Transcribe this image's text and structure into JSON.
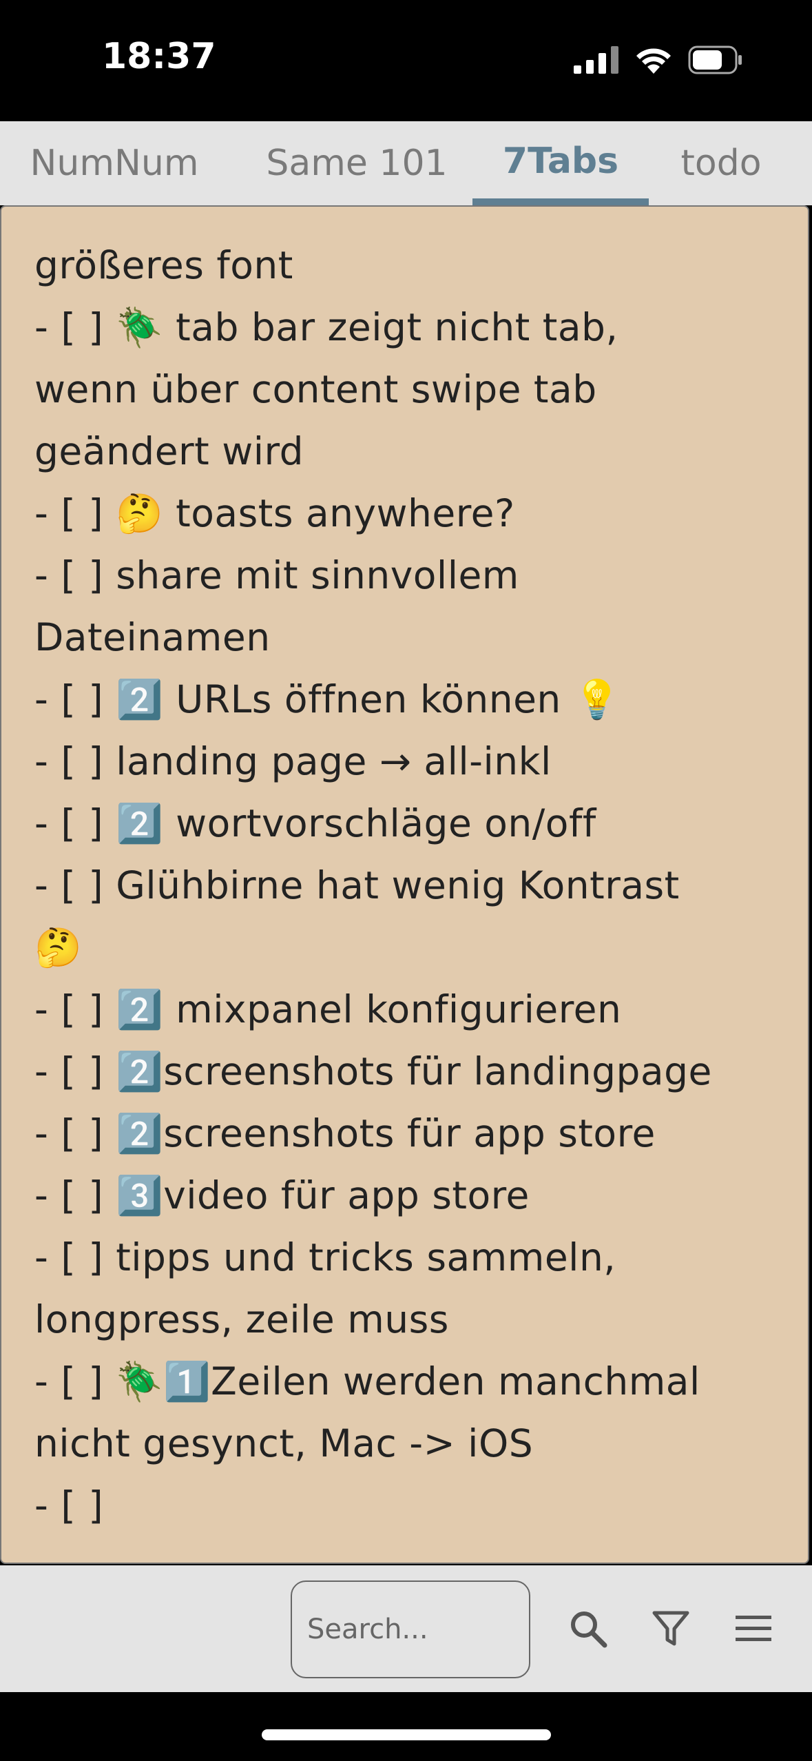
{
  "status_bar": {
    "time": "18:37"
  },
  "tabs": [
    {
      "label": "NumNum",
      "active": false
    },
    {
      "label": "Same 101",
      "active": false
    },
    {
      "label": "7Tabs",
      "active": true
    },
    {
      "label": "todo",
      "active": false
    }
  ],
  "content": {
    "background_color": "#e2cbae",
    "lines": [
      "größeres font",
      "- [ ] 🪲 tab bar zeigt nicht tab,",
      "wenn über content swipe tab",
      "geändert wird",
      "- [ ] 🤔  toasts anywhere?",
      "- [ ] share mit sinnvollem",
      "Dateinamen",
      "- [ ]  2️⃣ URLs öffnen können 💡",
      "- [ ] landing page  →  all-inkl",
      "- [ ] 2️⃣ wortvorschläge on/off",
      "- [ ] Glühbirne hat wenig Kontrast",
      "🤔",
      "- [ ] 2️⃣ mixpanel konfigurieren",
      "- [ ] 2️⃣screenshots für landingpage",
      "- [ ] 2️⃣screenshots für app store",
      "- [ ] 3️⃣video für app store",
      "- [ ] tipps und tricks sammeln,",
      "longpress, zeile muss",
      "- [ ] 🪲1️⃣Zeilen werden manchmal",
      "nicht gesynct, Mac -> iOS",
      "- [ ]"
    ]
  },
  "toolbar": {
    "search_placeholder": "Search...",
    "icons": [
      "search-icon",
      "filter-icon",
      "menu-icon"
    ]
  },
  "colors": {
    "accent": "#5f7f92",
    "tab_bar": "#e4e4e4"
  }
}
